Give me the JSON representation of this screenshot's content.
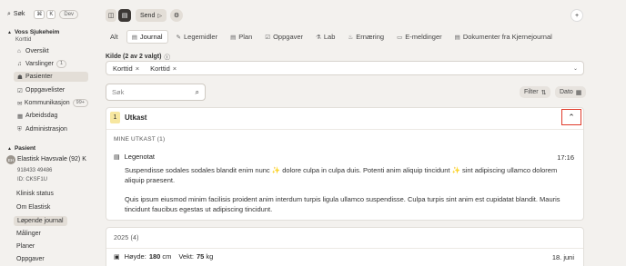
{
  "sidebar": {
    "search_label": "Søk",
    "kbd1": "⌘",
    "kbd2": "K",
    "dev": "Dev",
    "section1": "Voss Sjukeheim",
    "section1_sub": "Korttid",
    "items": [
      {
        "label": "Oversikt",
        "icon": "home-icon",
        "glyph": "⌂"
      },
      {
        "label": "Varslinger",
        "icon": "bell-icon",
        "glyph": "♫",
        "badge": "1"
      },
      {
        "label": "Pasienter",
        "icon": "users-icon",
        "glyph": "☗"
      },
      {
        "label": "Oppgavelister",
        "icon": "list-icon",
        "glyph": "☑"
      },
      {
        "label": "Kommunikasjon",
        "icon": "chat-icon",
        "glyph": "✉",
        "badge": "99+"
      },
      {
        "label": "Arbeidsdag",
        "icon": "calendar-icon",
        "glyph": "▦"
      },
      {
        "label": "Administrasjon",
        "icon": "shield-icon",
        "glyph": "⛨"
      }
    ],
    "section2": "Pasient",
    "patient_name": "Elastisk Havsvale (92) K",
    "patient_id": "918433 49486",
    "patient_extra": "ID: CKSF1U",
    "avatar": "EH",
    "patient_items": [
      "Klinisk status",
      "Om Elastisk",
      "Løpende journal",
      "Målinger",
      "Planer",
      "Oppgaver"
    ]
  },
  "toolbar": {
    "send": "Send",
    "add": "+"
  },
  "tabs": [
    {
      "label": "Alt",
      "glyph": ""
    },
    {
      "label": "Journal",
      "glyph": "▤"
    },
    {
      "label": "Legemidler",
      "glyph": "✎"
    },
    {
      "label": "Plan",
      "glyph": "▤"
    },
    {
      "label": "Oppgaver",
      "glyph": "☑"
    },
    {
      "label": "Lab",
      "glyph": "⚗"
    },
    {
      "label": "Ernæring",
      "glyph": "♨"
    },
    {
      "label": "E-meldinger",
      "glyph": "▭"
    },
    {
      "label": "Dokumenter fra Kjernejournal",
      "glyph": "▤"
    }
  ],
  "filter": {
    "source_label": "Kilde (2 av 2 valgt)",
    "chips": [
      "Korttid",
      "Korttid"
    ],
    "search_placeholder": "Søk",
    "filter_btn": "Filter",
    "date_btn": "Dato"
  },
  "draft": {
    "count": "1",
    "title": "Utkast",
    "group": "MINE UTKAST (1)",
    "note_title": "Legenotat",
    "note_time": "17:16",
    "para1": "Suspendisse sodales sodales blandit enim nunc ✨ dolore culpa in culpa duis. Potenti anim aliquip tincidunt ✨ sint adipiscing ullamco dolorem aliquip praesent.",
    "para2": "Quis ipsum eiusmod minim facilisis proident anim interdum turpis ligula ullamco suspendisse. Culpa turpis sint anim est cupidatat blandit. Mauris tincidunt faucibus egestas ut adipiscing tincidunt."
  },
  "year_group": {
    "title": "2025 (4)",
    "entry_height_label": "Høyde:",
    "entry_height_value": "180",
    "entry_height_unit": "cm",
    "entry_weight_label": "Vekt:",
    "entry_weight_value": "75",
    "entry_weight_unit": "kg",
    "entry_date": "18. juni"
  }
}
